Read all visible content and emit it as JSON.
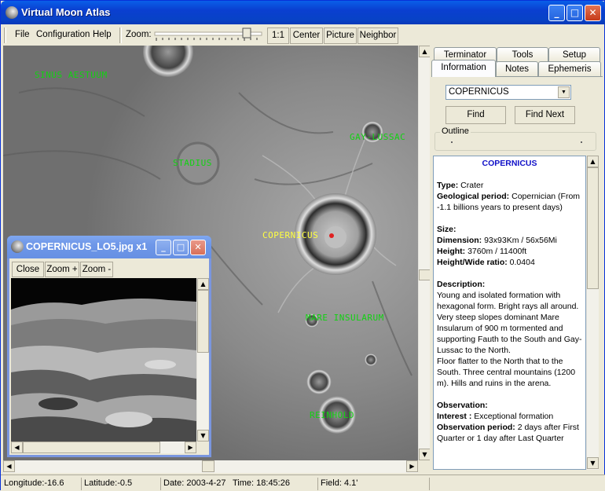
{
  "window": {
    "title": "Virtual Moon Atlas"
  },
  "menu": {
    "file": "File",
    "configuration": "Configuration",
    "help": "Help"
  },
  "toolbar": {
    "zoom_label": "Zoom:",
    "one_to_one": "1:1",
    "center": "Center",
    "picture": "Picture",
    "neighbor": "Neighbor"
  },
  "map_labels": {
    "sinus_aestuum": "SINUS AESTUUM",
    "stadius": "STADIUS",
    "gay_lussac": "GAY-LUSSAC",
    "copernicus": "COPERNICUS",
    "mare_insularum": "MARE INSULARUM",
    "reinhold": "REINHOLD"
  },
  "tabs": {
    "terminator": "Terminator",
    "tools": "Tools",
    "setup": "Setup",
    "information": "Information",
    "notes": "Notes",
    "ephemeris": "Ephemeris"
  },
  "search": {
    "value": "COPERNICUS",
    "find": "Find",
    "find_next": "Find Next",
    "outline": "Outline"
  },
  "info": {
    "title": "COPERNICUS",
    "type_label": "Type:",
    "type_value": "Crater",
    "geo_label": "Geological period:",
    "geo_value": "Copernician (From -1.1 billions years to present days)",
    "size_head": "Size:",
    "dim_label": "Dimension:",
    "dim_value": "93x93Km / 56x56Mi",
    "height_label": "Height:",
    "height_value": "3760m / 11400ft",
    "ratio_label": "Height/Wide ratio:",
    "ratio_value": "0.0404",
    "desc_head": "Description:",
    "desc_p1": "Young and isolated formation with hexagonal form. Bright rays all around. Very steep slopes dominant Mare Insularum of 900 m tormented and supporting Fauth to the South and Gay-Lussac to the North.",
    "desc_p2": "Floor flatter to the North that to the South. Three central mountains (1200 m). Hills and ruins in the arena.",
    "obs_head": "Observation:",
    "interest_label": "Interest :",
    "interest_value": "Exceptional formation",
    "period_label": "Observation period:",
    "period_value": "2 days after First Quarter or 1 day after Last Quarter"
  },
  "status": {
    "longitude": "Longitude:-16.6",
    "latitude": "Latitude:-0.5",
    "date": "Date: 2003-4-27",
    "time": "Time: 18:45:26",
    "field": "Field: 4.1'"
  },
  "child_window": {
    "title": "COPERNICUS_LO5.jpg x1",
    "close": "Close",
    "zoom_in": "Zoom +",
    "zoom_out": "Zoom -"
  }
}
